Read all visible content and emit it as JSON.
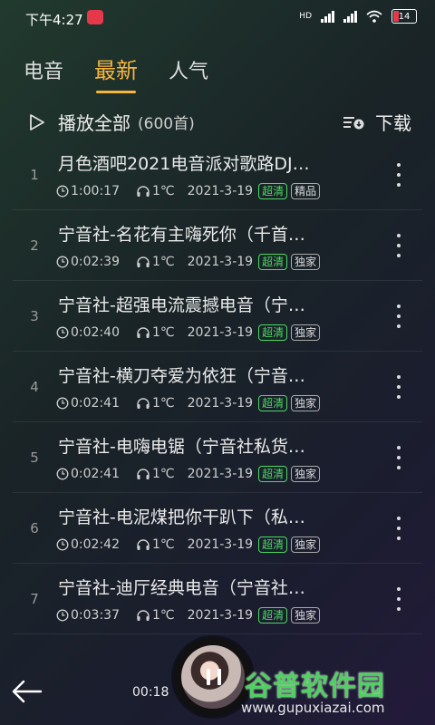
{
  "status": {
    "time": "下午4:27",
    "hd": "HD",
    "battery": "14"
  },
  "tabs": [
    {
      "label": "电音"
    },
    {
      "label": "最新"
    },
    {
      "label": "人气"
    }
  ],
  "toolbar": {
    "play_all": "播放全部",
    "count": "(600首)",
    "download": "下载"
  },
  "songs": [
    {
      "index": "1",
      "title": "月色酒吧2021电音派对歌路DJ…",
      "duration": "1:00:17",
      "temp": "1℃",
      "date": "2021-3-19",
      "quality": "超清",
      "tag": "精品"
    },
    {
      "index": "2",
      "title": "宁音社-名花有主嗨死你（千首…",
      "duration": "0:02:39",
      "temp": "1℃",
      "date": "2021-3-19",
      "quality": "超清",
      "tag": "独家"
    },
    {
      "index": "3",
      "title": "宁音社-超强电流震撼电音（宁…",
      "duration": "0:02:40",
      "temp": "1℃",
      "date": "2021-3-19",
      "quality": "超清",
      "tag": "独家"
    },
    {
      "index": "4",
      "title": "宁音社-横刀夺爱为依狂（宁音…",
      "duration": "0:02:41",
      "temp": "1℃",
      "date": "2021-3-19",
      "quality": "超清",
      "tag": "独家"
    },
    {
      "index": "5",
      "title": "宁音社-电嗨电锯（宁音社私货…",
      "duration": "0:02:41",
      "temp": "1℃",
      "date": "2021-3-19",
      "quality": "超清",
      "tag": "独家"
    },
    {
      "index": "6",
      "title": "宁音社-电泥煤把你干趴下（私…",
      "duration": "0:02:42",
      "temp": "1℃",
      "date": "2021-3-19",
      "quality": "超清",
      "tag": "独家"
    },
    {
      "index": "7",
      "title": "宁音社-迪厅经典电音（宁音社…",
      "duration": "0:03:37",
      "temp": "1℃",
      "date": "2021-3-19",
      "quality": "超清",
      "tag": "独家"
    }
  ],
  "player": {
    "time": "00:18"
  },
  "watermark": {
    "title": "谷普软件园",
    "url": "www.gupuxiazai.com"
  },
  "colors": {
    "accent": "#f6b53f",
    "quality": "#4cd964"
  }
}
